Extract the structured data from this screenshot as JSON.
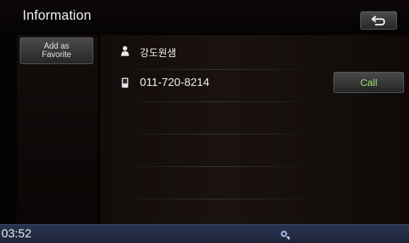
{
  "header": {
    "title": "Information",
    "back_icon": "return-arrow-icon"
  },
  "sidebar": {
    "favorite_line1": "Add as",
    "favorite_line2": "Favorite"
  },
  "contact": {
    "name": "강도원샘",
    "name_icon": "person-icon",
    "phone": "011-720-8214",
    "phone_icon": "mobile-phone-icon",
    "call_label": "Call"
  },
  "status_bar": {
    "time": "03:52",
    "status_icon": "gps-satellite-icon"
  },
  "colors": {
    "call_text": "#9fe16a",
    "status_bar": "#223049"
  }
}
